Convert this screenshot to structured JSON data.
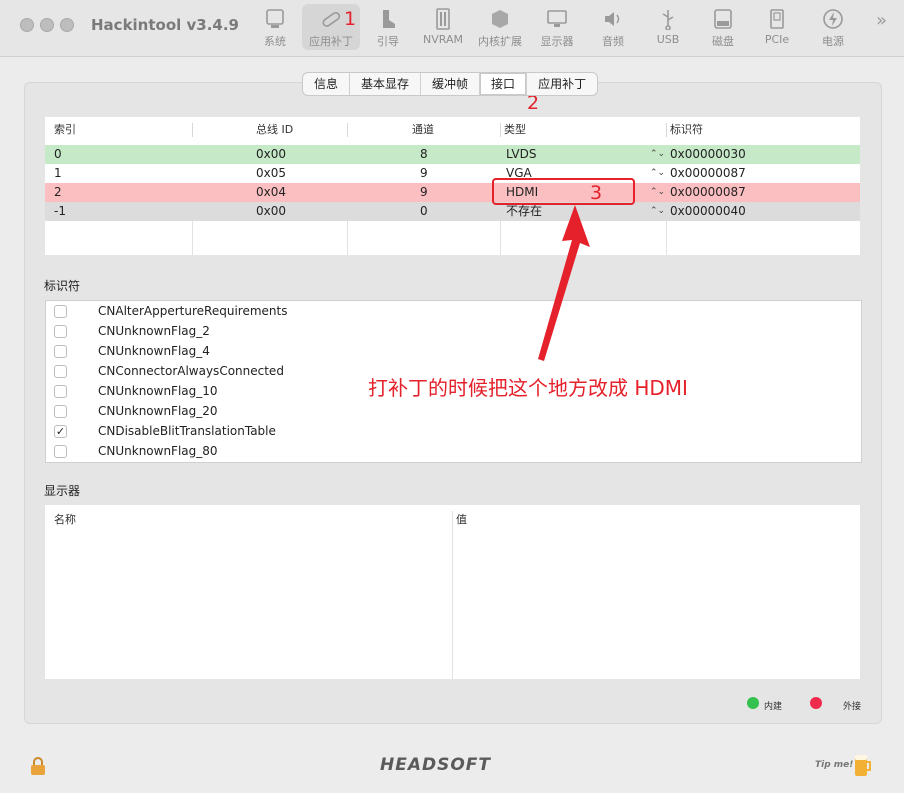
{
  "window": {
    "title": "Hackintool v3.4.9"
  },
  "toolbar": {
    "items": [
      {
        "label": "系统",
        "icon": "computer-icon"
      },
      {
        "label": "应用补丁",
        "icon": "bandage-icon"
      },
      {
        "label": "引导",
        "icon": "boot-icon"
      },
      {
        "label": "NVRAM",
        "icon": "memory-icon"
      },
      {
        "label": "内核扩展",
        "icon": "cube-icon"
      },
      {
        "label": "显示器",
        "icon": "display-icon"
      },
      {
        "label": "音频",
        "icon": "speaker-icon"
      },
      {
        "label": "USB",
        "icon": "usb-icon"
      },
      {
        "label": "磁盘",
        "icon": "disk-icon"
      },
      {
        "label": "PCIe",
        "icon": "pcie-icon"
      },
      {
        "label": "电源",
        "icon": "power-icon"
      }
    ],
    "overflow": "»"
  },
  "tabs": [
    "信息",
    "基本显存",
    "缓冲帧",
    "接口",
    "应用补丁"
  ],
  "connectors": {
    "headers": [
      "索引",
      "总线 ID",
      "通道",
      "类型",
      "标识符"
    ],
    "rows": [
      {
        "index": "0",
        "bus_id": "0x00",
        "pipe": "8",
        "type": "LVDS",
        "flags": "0x00000030"
      },
      {
        "index": "1",
        "bus_id": "0x05",
        "pipe": "9",
        "type": "VGA",
        "flags": "0x00000087"
      },
      {
        "index": "2",
        "bus_id": "0x04",
        "pipe": "9",
        "type": "HDMI",
        "flags": "0x00000087"
      },
      {
        "index": "-1",
        "bus_id": "0x00",
        "pipe": "0",
        "type": "不存在",
        "flags": "0x00000040"
      }
    ],
    "row_colors": [
      "#c6eac7",
      "#ffffff",
      "#fbbfc2",
      "#dcdcdc"
    ]
  },
  "flags_section": {
    "label": "标识符",
    "items": [
      {
        "name": "CNAlterAppertureRequirements",
        "checked": false
      },
      {
        "name": "CNUnknownFlag_2",
        "checked": false
      },
      {
        "name": "CNUnknownFlag_4",
        "checked": false
      },
      {
        "name": "CNConnectorAlwaysConnected",
        "checked": false
      },
      {
        "name": "CNUnknownFlag_10",
        "checked": false
      },
      {
        "name": "CNUnknownFlag_20",
        "checked": false
      },
      {
        "name": "CNDisableBlitTranslationTable",
        "checked": true
      },
      {
        "name": "CNUnknownFlag_80",
        "checked": false
      }
    ],
    "check_mark": "✓"
  },
  "display_section": {
    "label": "显示器",
    "headers": [
      "名称",
      "值"
    ]
  },
  "legend": [
    {
      "label": "内建",
      "color": "#33c24d"
    },
    {
      "label": "外接",
      "color": "#ef2c4c"
    }
  ],
  "footer": {
    "logo": "HEADSOFT",
    "tip": "Tip me!"
  },
  "annotations": {
    "n1": "1",
    "n2": "2",
    "n3": "3",
    "note": "打补丁的时候把这个地方改成 HDMI",
    "color": "#e5212b"
  },
  "updown_glyph": "⌃⌄"
}
